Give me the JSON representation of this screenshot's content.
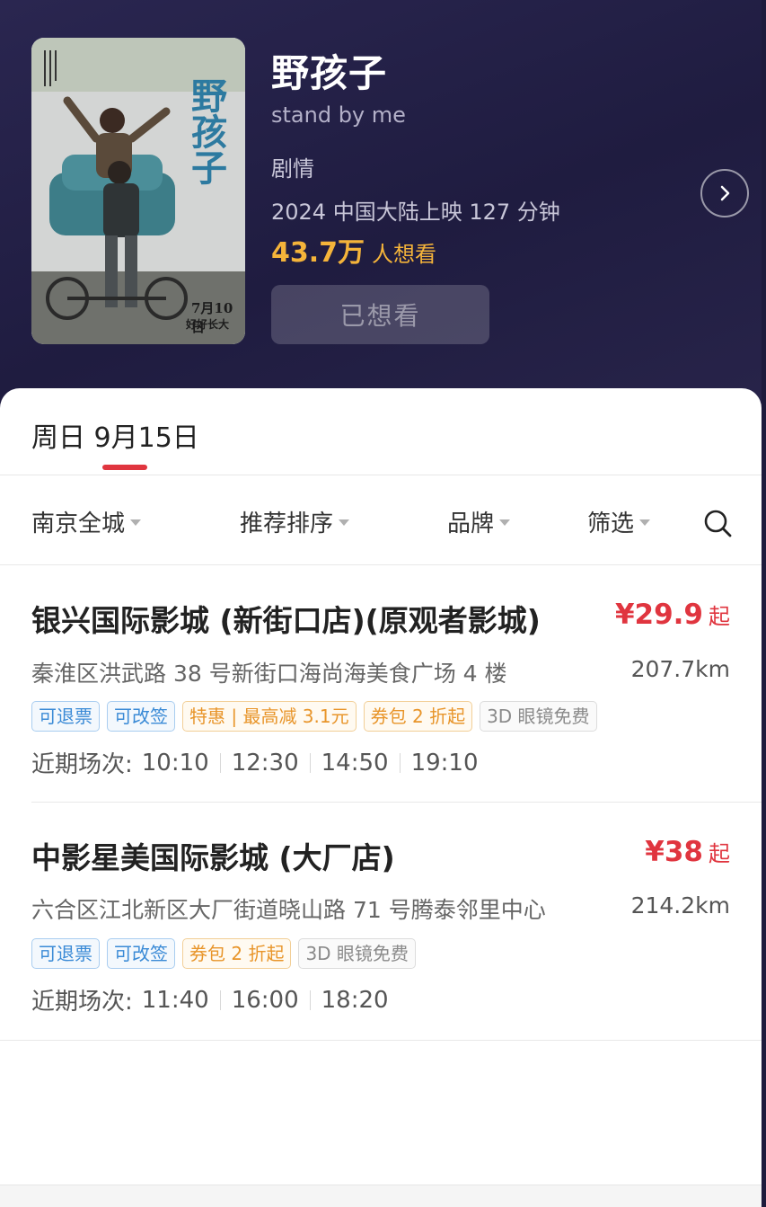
{
  "movie": {
    "title": "野孩子",
    "english_title": "stand by me",
    "genre": "剧情",
    "release_info": "2024 中国大陆上映 127 分钟",
    "want_count": "43.7万",
    "want_label": "人想看",
    "wanted_button_label": "已想看",
    "poster": {
      "title_text": "野孩子",
      "date_text": "7月10日",
      "slogan_text": "好好长大"
    }
  },
  "date_tab": {
    "label": "周日 9月15日"
  },
  "filters": {
    "city": "南京全城",
    "sort": "推荐排序",
    "brand": "品牌",
    "screen": "筛选"
  },
  "cinemas": [
    {
      "name": "银兴国际影城 (新街口店)(原观者影城)",
      "price": "¥29.9",
      "price_suffix": "起",
      "address": "秦淮区洪武路 38 号新街口海尚海美食广场 4 楼",
      "distance": "207.7km",
      "tags": [
        "可退票",
        "可改签",
        "特惠 | 最高减 3.1元",
        "券包 2 折起",
        "3D 眼镜免费"
      ],
      "showtimes_label": "近期场次:",
      "showtimes": [
        "10:10",
        "12:30",
        "14:50",
        "19:10"
      ]
    },
    {
      "name": "中影星美国际影城 (大厂店)",
      "price": "¥38",
      "price_suffix": "起",
      "address": "六合区江北新区大厂街道晓山路 71 号腾泰邻里中心",
      "distance": "214.2km",
      "tags": [
        "可退票",
        "可改签",
        "券包 2 折起",
        "3D 眼镜免费"
      ],
      "showtimes_label": "近期场次:",
      "showtimes": [
        "11:40",
        "16:00",
        "18:20"
      ]
    }
  ],
  "colors": {
    "header_bg": "#25224a",
    "accent_red": "#e0353f",
    "want_yellow": "#f5b43a",
    "tag_blue": "#3a8ad6",
    "tag_orange": "#e8952a"
  },
  "icons": {
    "detail": "chevron-right-icon",
    "search": "search-icon",
    "dropdown": "caret-down-icon"
  }
}
